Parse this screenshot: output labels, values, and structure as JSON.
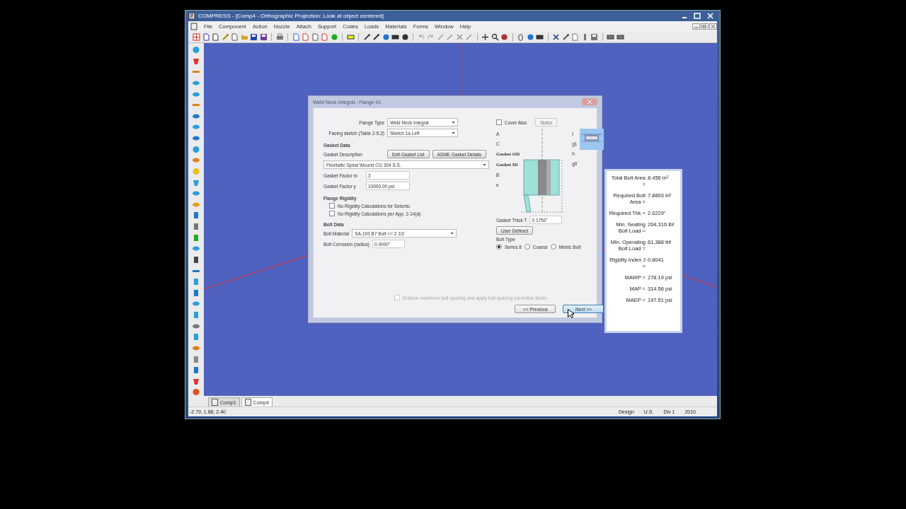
{
  "window": {
    "title": "COMPRESS - [Comp4 - Orthographic Projection: Look at object centered]"
  },
  "menu": [
    "File",
    "Component",
    "Action",
    "Nozzle",
    "Attach",
    "Support",
    "Codes",
    "Loads",
    "Materials",
    "Forms",
    "Window",
    "Help"
  ],
  "dialog": {
    "title": "Weld Neck Integral - Flange #1",
    "flange_type": {
      "label": "Flange Type",
      "value": "Weld Neck Integral"
    },
    "facing_sketch": {
      "label": "Facing sketch (Table 2-5.2)",
      "value": "Sketch 1a Left"
    },
    "cover_also": {
      "label": "Cover Also",
      "checked": false
    },
    "notes_button": {
      "label": "Notes",
      "disabled": true
    },
    "gasket_section": "Gasket Data",
    "gasket_description_label": "Gasket Description",
    "edit_gasket_button": "Edit Gasket List",
    "asme_gasket_button": "ASME Gasket Details",
    "gasket": "Flexitallic Spiral Wound CG 304 S.S.",
    "gasket_factor_m": {
      "label": "Gasket Factor m",
      "value": "3"
    },
    "gasket_factor_y": {
      "label": "Gasket Factor y",
      "value": "10000.00 psi"
    },
    "gasket_thick": {
      "label": "Gasket Thick T",
      "value": "0.1750\""
    },
    "rigidity_section": "Flange Rigidity",
    "rigidity_options": [
      {
        "label": "No Rigidity Calculations for Seismic",
        "checked": false
      },
      {
        "label": "No Rigidity Calculations per App. 2-14(a)",
        "checked": false
      }
    ],
    "bolt_section": "Bolt Data",
    "bolt_material": {
      "label": "Bolt Material",
      "value": "SA-193 B7 Bolt <= 2 1/2"
    },
    "user_defined_button": "User Defined",
    "bolt_type": {
      "label": "Bolt Type",
      "options": [
        {
          "label": "Series 8",
          "selected": true
        },
        {
          "label": "Coarse",
          "selected": false
        },
        {
          "label": "Metric Bolt",
          "selected": false
        }
      ]
    },
    "bolt_corrosion": {
      "label": "Bolt Corrosion (radius)",
      "value": "0.0000\""
    },
    "bolt_spacing": {
      "label": "Enforce maximum bolt spacing and apply bolt spacing correction factor",
      "checked": false,
      "disabled": true
    },
    "buttons": [
      "<< Previous",
      "Next >>"
    ],
    "diagram_labels": {
      "a": "A",
      "c": "C",
      "gasket_od": "Gasket OD",
      "gasket_id": "Gasket ID",
      "b": "B",
      "t": "t",
      "e": "e",
      "g1": "g1",
      "h": "h",
      "g0": "g0"
    }
  },
  "results": [
    {
      "label": "Total Bolt Area =",
      "value": "8.456  in²"
    },
    {
      "label": "Required Bolt Area =",
      "value": "7.8893  in²"
    },
    {
      "label": "Required Thk =",
      "value": "2.0229\""
    },
    {
      "label": "Min. Seating Bolt Load =",
      "value": "204,316 lbf"
    },
    {
      "label": "Min. Operating Bolt Load =",
      "value": "61,388 lbf"
    },
    {
      "label": "Rigidity Index J =",
      "value": "0.8041"
    },
    {
      "label": "MAWP =",
      "value": "278.19 psi"
    },
    {
      "label": "MAP =",
      "value": "314.56 psi"
    },
    {
      "label": "MAEP =",
      "value": "197.51 psi"
    }
  ],
  "document_tabs": [
    {
      "label": "Comp1",
      "selected": false
    },
    {
      "label": "Comp4",
      "selected": true
    }
  ],
  "status_bar": {
    "coordinates": "-2.79, 1.88, 2.40",
    "mode": "Design",
    "units": "U.S.",
    "division": "Div 1",
    "edition": "2010"
  }
}
